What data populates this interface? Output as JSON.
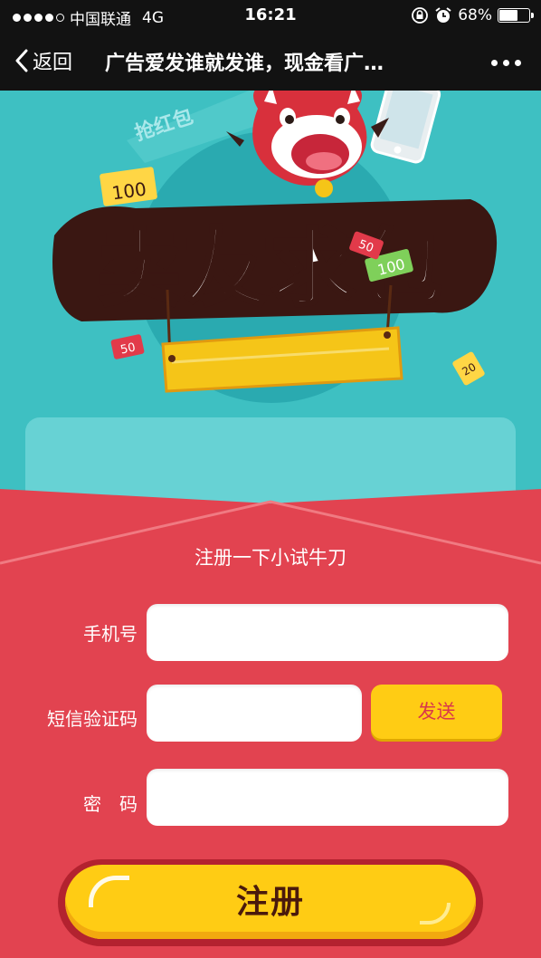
{
  "status_bar": {
    "carrier": "中国联通",
    "network": "4G",
    "time": "16:21",
    "battery": "68%",
    "battery_level": 0.68,
    "signal_dots_filled": 4,
    "signal_dots_total": 5
  },
  "nav": {
    "back_label": "返回",
    "title": "广告爱发谁就发谁，现金看广…"
  },
  "hero": {
    "banner_text": "卖友求包",
    "ribbon_text": "抢红包",
    "badges": [
      "100",
      "100",
      "50",
      "50",
      "20"
    ]
  },
  "form": {
    "title": "注册一下小试牛刀",
    "phone_label": "手机号",
    "phone_value": "",
    "code_label": "短信验证码",
    "code_value": "",
    "send_label": "发送",
    "password_label": "密　码",
    "password_value": "",
    "submit_label": "注册"
  },
  "colors": {
    "nav_bg": "#121212",
    "teal_bg": "#3ec0c2",
    "envelope_red": "#e24350",
    "button_yellow": "#ffcc14",
    "send_text": "#d9384b",
    "submit_text": "#4a1a0c"
  },
  "icons": [
    "signal-dots-icon",
    "lock-rotation-icon",
    "alarm-icon",
    "battery-icon",
    "back-chevron-icon",
    "more-dots-icon",
    "bull-mascot-icon",
    "phone-icon",
    "money-badge-icon",
    "wooden-sign-icon"
  ]
}
